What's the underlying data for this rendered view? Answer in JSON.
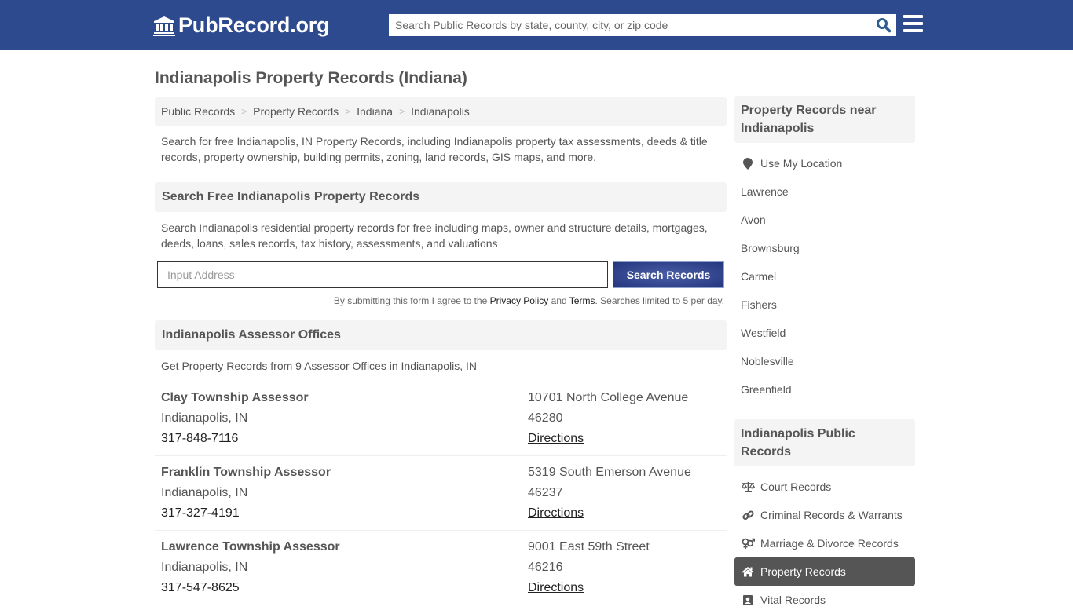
{
  "header": {
    "logo_text": "PubRecord.org",
    "search_placeholder": "Search Public Records by state, county, city, or zip code",
    "colors": {
      "brand": "#2e4a8f",
      "search_icon": "#2e5d8f"
    }
  },
  "page_title": "Indianapolis Property Records (Indiana)",
  "breadcrumb": [
    {
      "label": "Public Records"
    },
    {
      "label": "Property Records"
    },
    {
      "label": "Indiana"
    },
    {
      "label": "Indianapolis"
    }
  ],
  "intro": "Search for free Indianapolis, IN Property Records, including Indianapolis property tax assessments, deeds & title records, property ownership, building permits, zoning, land records, GIS maps, and more.",
  "search_section": {
    "heading": "Search Free Indianapolis Property Records",
    "description": "Search Indianapolis residential property records for free including maps, owner and structure details, mortgages, deeds, loans, sales records, tax history, assessments, and valuations",
    "address_placeholder": "Input Address",
    "submit_label": "Search Records",
    "disclaimer_prefix": "By submitting this form I agree to the ",
    "privacy_label": "Privacy Policy",
    "and_text": " and ",
    "terms_label": "Terms",
    "disclaimer_suffix": ". Searches limited to 5 per day."
  },
  "offices_section": {
    "heading": "Indianapolis Assessor Offices",
    "description": "Get Property Records from 9 Assessor Offices in Indianapolis, IN",
    "offices": [
      {
        "name": "Clay Township Assessor",
        "city": "Indianapolis, IN",
        "phone": "317-848-7116",
        "street": "10701 North College Avenue",
        "zip": "46280",
        "directions": "Directions"
      },
      {
        "name": "Franklin Township Assessor",
        "city": "Indianapolis, IN",
        "phone": "317-327-4191",
        "street": "5319 South Emerson Avenue",
        "zip": "46237",
        "directions": "Directions"
      },
      {
        "name": "Lawrence Township Assessor",
        "city": "Indianapolis, IN",
        "phone": "317-547-8625",
        "street": "9001 East 59th Street",
        "zip": "46216",
        "directions": "Directions"
      }
    ]
  },
  "sidebar": {
    "nearby": {
      "heading": "Property Records near Indianapolis",
      "use_location": "Use My Location",
      "cities": [
        "Lawrence",
        "Avon",
        "Brownsburg",
        "Carmel",
        "Fishers",
        "Westfield",
        "Noblesville",
        "Greenfield"
      ]
    },
    "public_records": {
      "heading": "Indianapolis Public Records",
      "items": [
        {
          "label": "Court Records",
          "icon": "scale-icon"
        },
        {
          "label": "Criminal Records & Warrants",
          "icon": "link-icon"
        },
        {
          "label": "Marriage & Divorce Records",
          "icon": "gender-icon"
        },
        {
          "label": "Property Records",
          "icon": "home-icon",
          "active": true
        },
        {
          "label": "Vital Records",
          "icon": "id-card-icon"
        }
      ]
    }
  }
}
